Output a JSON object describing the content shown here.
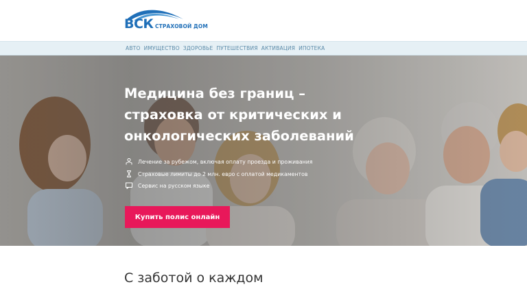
{
  "header": {
    "logo_main": "ВСК",
    "logo_sub": "СТРАХОВОЙ ДОМ"
  },
  "nav": {
    "items": [
      {
        "label": "АВТО"
      },
      {
        "label": "ИМУЩЕСТВО"
      },
      {
        "label": "ЗДОРОВЬЕ"
      },
      {
        "label": "ПУТЕШЕСТВИЯ"
      },
      {
        "label": "АКТИВАЦИЯ"
      },
      {
        "label": "ИПОТЕКА"
      }
    ]
  },
  "hero": {
    "title": "Медицина без границ – страховка от критических и онкологических заболеваний",
    "features": [
      {
        "icon": "person-icon",
        "text": "Лечение за рубежом, включая оплату проезда и проживания"
      },
      {
        "icon": "hourglass-icon",
        "text": "Страховые лимиты до 2 млн. евро с оплатой медикаментов"
      },
      {
        "icon": "chat-icon",
        "text": "Сервис на русском языке"
      }
    ],
    "button_label": "Купить полис онлайн"
  },
  "section": {
    "title": "С заботой о каждом"
  },
  "colors": {
    "brand_blue": "#1f6fb8",
    "nav_bg": "#e6f0f5",
    "button_pink": "#e8185a"
  }
}
